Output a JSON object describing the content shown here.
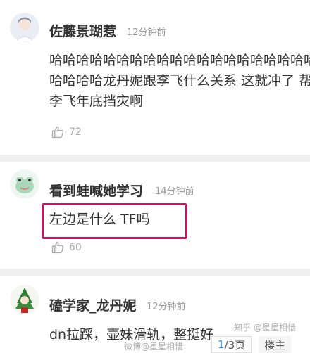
{
  "comments": [
    {
      "username": "佐藤景瑚惹",
      "time": "12分钟前",
      "lines": [
        "哈哈哈哈哈哈哈哈哈哈哈哈哈哈哈哈哈哈哈哈哈哈哈哈",
        "哈哈哈哈龙丹妮跟李飞什么关系 这就冲了 帮",
        "李飞年底挡灾啊"
      ],
      "likes": "72"
    },
    {
      "username": "看到蛙喊她学习",
      "time": "14分钟前",
      "lines": [
        "左边是什么 TF吗"
      ],
      "likes": "60"
    },
    {
      "username": "磕学家_龙丹妮",
      "time": "12分钟前",
      "lines": [
        "dn拉踩，壶妹滑轨，整挺好"
      ],
      "likes": ""
    }
  ],
  "watermarks": {
    "zhihu": "知乎 @星星相惜",
    "weibo": "微博@星星相惜"
  },
  "pager": {
    "current": "1",
    "total": "/3页",
    "owner_label": "楼主"
  },
  "colors": {
    "highlight": "#c2185b",
    "username": "#333333",
    "time": "#999999"
  }
}
